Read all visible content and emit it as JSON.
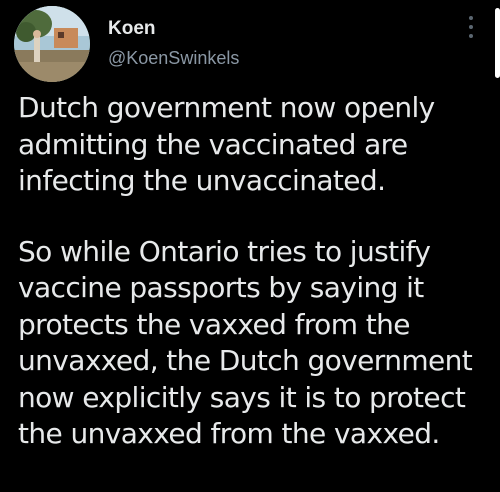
{
  "tweet": {
    "author": {
      "display_name": "Koen",
      "handle": "@KoenSwinkels",
      "avatar_icon": "profile-photo"
    },
    "more_icon": "more-vertical-icon",
    "paragraphs": [
      {
        "lines": [
          "Dutch government now openly",
          "admitting the vaccinated are",
          "infecting the unvaccinated."
        ]
      },
      {
        "lines": [
          "So while Ontario tries to justify",
          "vaccine passports by saying it",
          "protects the vaxxed from the",
          "unvaxxed, the Dutch government",
          "now explicitly says it is to protect",
          "the unvaxxed from the vaxxed."
        ]
      }
    ],
    "colors": {
      "background": "#000000",
      "text": "#e7e9ea",
      "secondary": "#8b98a5"
    }
  }
}
